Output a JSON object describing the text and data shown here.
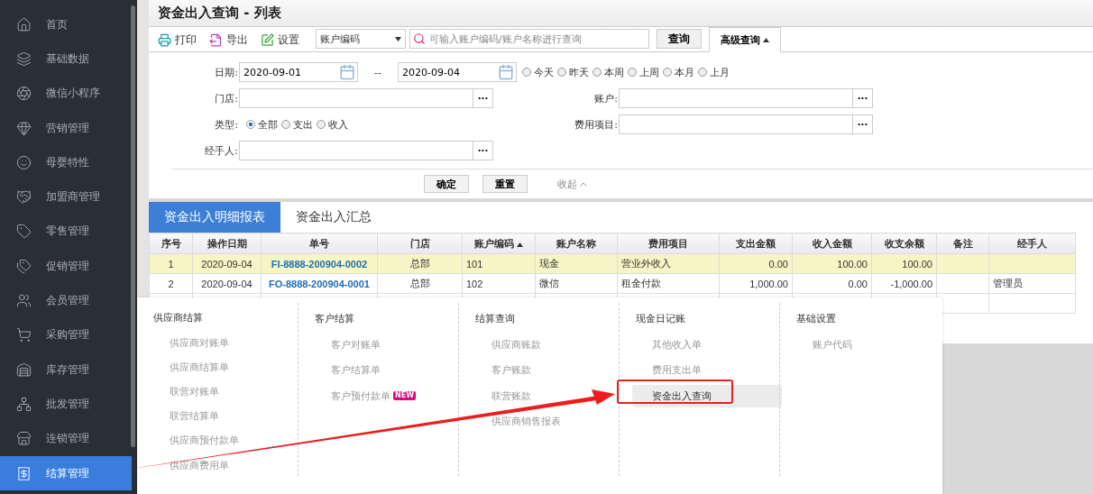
{
  "sidebar": {
    "items": [
      {
        "label": "首页",
        "selected": false
      },
      {
        "label": "基础数据",
        "selected": false
      },
      {
        "label": "微信小程序",
        "selected": false
      },
      {
        "label": "营销管理",
        "selected": false
      },
      {
        "label": "母婴特性",
        "selected": false
      },
      {
        "label": "加盟商管理",
        "selected": false
      },
      {
        "label": "零售管理",
        "selected": false
      },
      {
        "label": "促销管理",
        "selected": false
      },
      {
        "label": "会员管理",
        "selected": false
      },
      {
        "label": "采购管理",
        "selected": false
      },
      {
        "label": "库存管理",
        "selected": false
      },
      {
        "label": "批发管理",
        "selected": false
      },
      {
        "label": "连锁管理",
        "selected": false
      },
      {
        "label": "结算管理",
        "selected": true
      }
    ]
  },
  "page_title": "资金出入查询 - 列表",
  "toolbar": {
    "buttons": [
      {
        "label": "打印",
        "kind": "print"
      },
      {
        "label": "导出",
        "kind": "export"
      },
      {
        "label": "设置",
        "kind": "settings"
      }
    ],
    "search_by": "账户编码",
    "search": {
      "placeholder": "可输入账户编码/账户名称进行查询"
    },
    "query_button": "查询",
    "advanced_tab": {
      "label": "高级查询",
      "expanded": true
    }
  },
  "filters": {
    "date": {
      "label": "日期:",
      "from": "2020-09-01",
      "separator": "--",
      "to": "2020-09-04",
      "presets": [
        {
          "label": "今天",
          "selected": false
        },
        {
          "label": "昨天",
          "selected": false
        },
        {
          "label": "本周",
          "selected": false
        },
        {
          "label": "上周",
          "selected": false
        },
        {
          "label": "本月",
          "selected": false
        },
        {
          "label": "上月",
          "selected": false
        }
      ]
    },
    "store": {
      "label": "门店:",
      "button": "···"
    },
    "account": {
      "label": "账户:",
      "button": "···"
    },
    "type": {
      "label": "类型:",
      "options": [
        {
          "label": "全部",
          "selected": true
        },
        {
          "label": "支出",
          "selected": false
        },
        {
          "label": "收入",
          "selected": false
        }
      ]
    },
    "expense_item": {
      "label": "费用项目:",
      "button": "···"
    },
    "handler": {
      "label": "经手人:",
      "button": "···"
    },
    "confirm_button": "确定",
    "reset_button": "重置",
    "collapse": {
      "label": "收起",
      "expanded": true
    }
  },
  "report_tabs": [
    {
      "label": "资金出入明细报表",
      "selected": true
    },
    {
      "label": "资金出入汇总",
      "selected": false
    }
  ],
  "table": {
    "columns": [
      {
        "label": "序号",
        "sorted": false
      },
      {
        "label": "操作日期",
        "sorted": false
      },
      {
        "label": "单号",
        "sorted": false
      },
      {
        "label": "门店",
        "sorted": false
      },
      {
        "label": "账户编码",
        "sorted": true
      },
      {
        "label": "账户名称",
        "sorted": false
      },
      {
        "label": "费用项目",
        "sorted": false
      },
      {
        "label": "支出金额",
        "sorted": false
      },
      {
        "label": "收入金额",
        "sorted": false
      },
      {
        "label": "收支余额",
        "sorted": false
      },
      {
        "label": "备注",
        "sorted": false
      },
      {
        "label": "经手人",
        "sorted": false
      }
    ],
    "rows": [
      {
        "selected": true,
        "cells": [
          "1",
          "2020-09-04",
          "FI-8888-200904-0002",
          "总部",
          "101",
          "现金",
          "营业外收入",
          "0.00",
          "100.00",
          "100.00",
          "",
          ""
        ]
      },
      {
        "selected": false,
        "cells": [
          "2",
          "2020-09-04",
          "FO-8888-200904-0001",
          "总部",
          "102",
          "微信",
          "租金付款",
          "1,000.00",
          "0.00",
          "-1,000.00",
          "",
          "管理员"
        ]
      }
    ]
  },
  "flyout_menu": {
    "columns": [
      {
        "title": "供应商结算",
        "items": [
          {
            "label": "供应商对账单",
            "selected": false
          },
          {
            "label": "供应商结算单",
            "selected": false
          },
          {
            "label": "联营对账单",
            "selected": false
          },
          {
            "label": "联营结算单",
            "selected": false
          },
          {
            "label": "供应商预付款单",
            "selected": false
          },
          {
            "label": "供应商费用单",
            "selected": false
          }
        ]
      },
      {
        "title": "客户结算",
        "items": [
          {
            "label": "客户对账单",
            "selected": false
          },
          {
            "label": "客户结算单",
            "selected": false
          },
          {
            "label": "客户预付款单",
            "selected": false,
            "badge": "NEW"
          }
        ]
      },
      {
        "title": "结算查询",
        "items": [
          {
            "label": "供应商账款",
            "selected": false
          },
          {
            "label": "客户账款",
            "selected": false
          },
          {
            "label": "联营账款",
            "selected": false
          },
          {
            "label": "供应商销售报表",
            "selected": false
          }
        ]
      },
      {
        "title": "现金日记账",
        "items": [
          {
            "label": "其他收入单",
            "selected": false
          },
          {
            "label": "费用支出单",
            "selected": false
          },
          {
            "label": "资金出入查询",
            "selected": true
          }
        ]
      },
      {
        "title": "基础设置",
        "items": [
          {
            "label": "账户代码",
            "selected": false
          }
        ]
      }
    ]
  }
}
